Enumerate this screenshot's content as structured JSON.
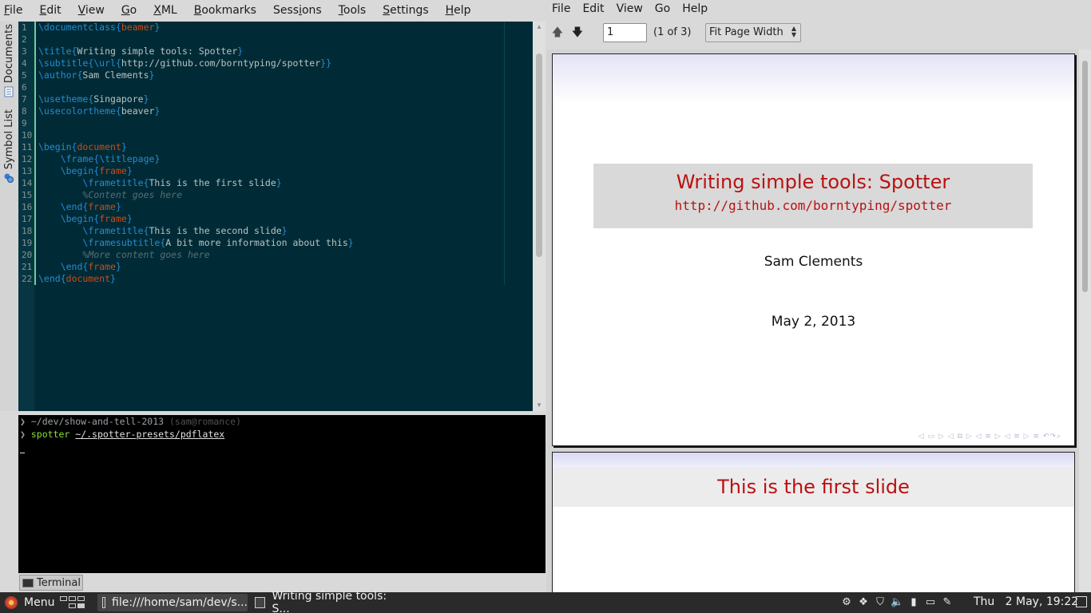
{
  "kate": {
    "menu": [
      {
        "pre": "",
        "u": "F",
        "post": "ile"
      },
      {
        "pre": "",
        "u": "E",
        "post": "dit"
      },
      {
        "pre": "",
        "u": "V",
        "post": "iew"
      },
      {
        "pre": "",
        "u": "G",
        "post": "o"
      },
      {
        "pre": "",
        "u": "X",
        "post": "ML"
      },
      {
        "pre": "",
        "u": "B",
        "post": "ookmarks"
      },
      {
        "pre": "Sess",
        "u": "i",
        "post": "ons"
      },
      {
        "pre": "",
        "u": "T",
        "post": "ools"
      },
      {
        "pre": "",
        "u": "S",
        "post": "ettings"
      },
      {
        "pre": "",
        "u": "H",
        "post": "elp"
      }
    ],
    "sidetabs": {
      "documents": "Documents",
      "symbols": "Symbol List"
    },
    "line_numbers": [
      "1",
      "2",
      "3",
      "4",
      "5",
      "6",
      "7",
      "8",
      "9",
      "10",
      "11",
      "12",
      "13",
      "14",
      "15",
      "16",
      "17",
      "18",
      "19",
      "20",
      "21",
      "22"
    ],
    "code": [
      [
        [
          "kw",
          "\\documentclass"
        ],
        [
          "br",
          "{"
        ],
        [
          "arg",
          "beamer"
        ],
        [
          "br",
          "}"
        ]
      ],
      [],
      [
        [
          "kw",
          "\\title"
        ],
        [
          "br",
          "{"
        ],
        [
          "plain",
          "Writing simple tools: Spotter"
        ],
        [
          "br",
          "}"
        ]
      ],
      [
        [
          "kw",
          "\\subtitle"
        ],
        [
          "br",
          "{"
        ],
        [
          "kw",
          "\\url"
        ],
        [
          "br",
          "{"
        ],
        [
          "plain",
          "http://github.com/borntyping/spotter"
        ],
        [
          "br",
          "}}"
        ]
      ],
      [
        [
          "kw",
          "\\author"
        ],
        [
          "br",
          "{"
        ],
        [
          "plain",
          "Sam Clements"
        ],
        [
          "br",
          "}"
        ]
      ],
      [],
      [
        [
          "kw",
          "\\usetheme"
        ],
        [
          "br",
          "{"
        ],
        [
          "plain",
          "Singapore"
        ],
        [
          "br",
          "}"
        ]
      ],
      [
        [
          "kw",
          "\\usecolortheme"
        ],
        [
          "br",
          "{"
        ],
        [
          "plain",
          "beaver"
        ],
        [
          "br",
          "}"
        ]
      ],
      [],
      [],
      [
        [
          "kw",
          "\\begin"
        ],
        [
          "br",
          "{"
        ],
        [
          "arg",
          "document"
        ],
        [
          "br",
          "}"
        ]
      ],
      [
        [
          "plain",
          "    "
        ],
        [
          "kw",
          "\\frame"
        ],
        [
          "br",
          "{"
        ],
        [
          "kw",
          "\\titlepage"
        ],
        [
          "br",
          "}"
        ]
      ],
      [
        [
          "plain",
          "    "
        ],
        [
          "kw",
          "\\begin"
        ],
        [
          "br",
          "{"
        ],
        [
          "arg",
          "frame"
        ],
        [
          "br",
          "}"
        ]
      ],
      [
        [
          "plain",
          "        "
        ],
        [
          "kw",
          "\\frametitle"
        ],
        [
          "br",
          "{"
        ],
        [
          "plain",
          "This is the first slide"
        ],
        [
          "br",
          "}"
        ]
      ],
      [
        [
          "plain",
          "        "
        ],
        [
          "cmt",
          "%Content goes here"
        ]
      ],
      [
        [
          "plain",
          "    "
        ],
        [
          "kw",
          "\\end"
        ],
        [
          "br",
          "{"
        ],
        [
          "arg",
          "frame"
        ],
        [
          "br",
          "}"
        ]
      ],
      [
        [
          "plain",
          "    "
        ],
        [
          "kw",
          "\\begin"
        ],
        [
          "br",
          "{"
        ],
        [
          "arg",
          "frame"
        ],
        [
          "br",
          "}"
        ]
      ],
      [
        [
          "plain",
          "        "
        ],
        [
          "kw",
          "\\frametitle"
        ],
        [
          "br",
          "{"
        ],
        [
          "plain",
          "This is the second slide"
        ],
        [
          "br",
          "}"
        ]
      ],
      [
        [
          "plain",
          "        "
        ],
        [
          "kw",
          "\\framesubtitle"
        ],
        [
          "br",
          "{"
        ],
        [
          "plain",
          "A bit more information about this"
        ],
        [
          "br",
          "}"
        ]
      ],
      [
        [
          "plain",
          "        "
        ],
        [
          "cmt",
          "%More content goes here"
        ]
      ],
      [
        [
          "plain",
          "    "
        ],
        [
          "kw",
          "\\end"
        ],
        [
          "br",
          "{"
        ],
        [
          "arg",
          "frame"
        ],
        [
          "br",
          "}"
        ]
      ],
      [
        [
          "kw",
          "\\end"
        ],
        [
          "br",
          "{"
        ],
        [
          "arg",
          "document"
        ],
        [
          "br",
          "}"
        ]
      ]
    ],
    "terminal": {
      "prompt_glyph": "❯",
      "cwd": "~/dev/show-and-tell-2013",
      "user_host": "(sam@romance)",
      "command": "spotter",
      "command_arg": "~/.spotter-presets/pdflatex",
      "tab_label": "Terminal"
    }
  },
  "okular": {
    "menu": [
      "File",
      "Edit",
      "View",
      "Go",
      "Help"
    ],
    "page_input": "1",
    "page_count": "(1 of 3)",
    "zoom": "Fit Page Width",
    "slide1": {
      "title": "Writing simple tools:  Spotter",
      "subtitle": "http://github.com/borntyping/spotter",
      "author": "Sam Clements",
      "date": "May 2, 2013",
      "nav_symbols": "◁ ▭ ▷  ◁ ⧉ ▷  ◁ ≡ ▷  ◁ ≡ ▷   ≡   ↶↷⌕"
    },
    "slide2": {
      "frametitle": "This is the first slide"
    }
  },
  "taskbar": {
    "menu_label": "Menu",
    "tasks": [
      "file:///home/sam/dev/s...",
      "Writing simple tools: S..."
    ],
    "clock": "Thu   2 May, 19:22"
  },
  "colors": {
    "editor_bg": "#002b36",
    "keyword": "#268bd2",
    "argument": "#cb4b16",
    "slide_title_red": "#bb1111"
  }
}
